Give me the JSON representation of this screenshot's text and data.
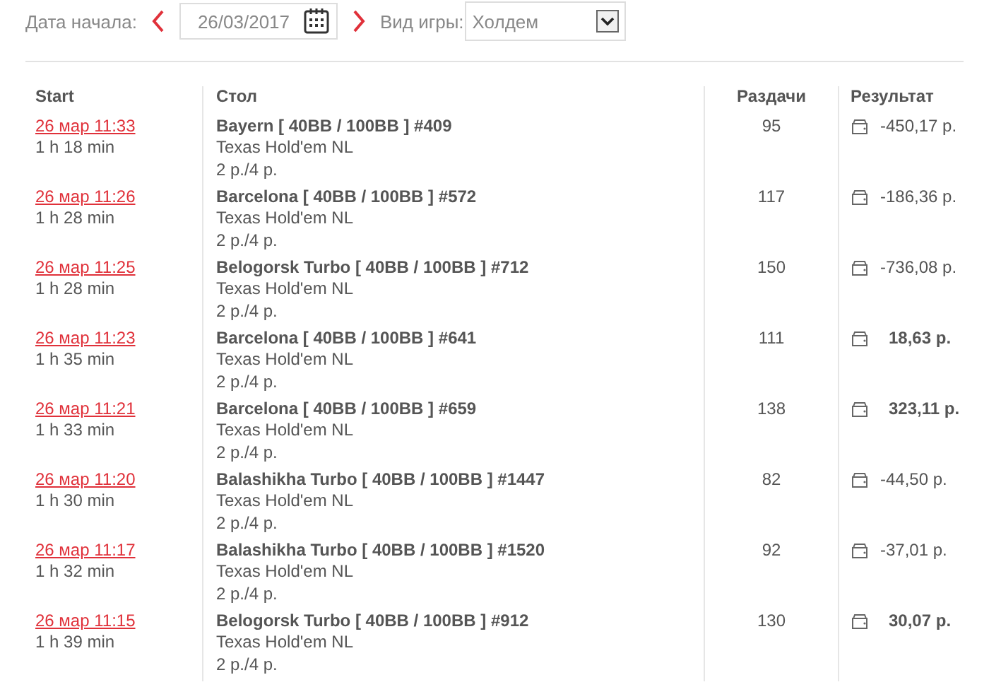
{
  "filter": {
    "date_label": "Дата начала:",
    "date_value": "26/03/2017",
    "game_label": "Вид игры:",
    "game_value": "Холдем"
  },
  "table": {
    "columns": [
      "Start",
      "Стол",
      "Раздачи",
      "Результат"
    ],
    "rows": [
      {
        "start": "26 мар 11:33",
        "duration": "1 h 18 min",
        "table": "Bayern [ 40BB / 100BB ] #409",
        "game": "Texas Hold'em NL",
        "stakes": "2 р./4 р.",
        "hands": "95",
        "result": "-450,17 р.",
        "win": false
      },
      {
        "start": "26 мар 11:26",
        "duration": "1 h 28 min",
        "table": "Barcelona [ 40BB / 100BB ] #572",
        "game": "Texas Hold'em NL",
        "stakes": "2 р./4 р.",
        "hands": "117",
        "result": "-186,36 р.",
        "win": false
      },
      {
        "start": "26 мар 11:25",
        "duration": "1 h 28 min",
        "table": "Belogorsk Turbo [ 40BB / 100BB ] #712",
        "game": "Texas Hold'em NL",
        "stakes": "2 р./4 р.",
        "hands": "150",
        "result": "-736,08 р.",
        "win": false
      },
      {
        "start": "26 мар 11:23",
        "duration": "1 h 35 min",
        "table": "Barcelona [ 40BB / 100BB ] #641",
        "game": "Texas Hold'em NL",
        "stakes": "2 р./4 р.",
        "hands": "111",
        "result": "18,63 р.",
        "win": true
      },
      {
        "start": "26 мар 11:21",
        "duration": "1 h 33 min",
        "table": "Barcelona [ 40BB / 100BB ] #659",
        "game": "Texas Hold'em NL",
        "stakes": "2 р./4 р.",
        "hands": "138",
        "result": "323,11 р.",
        "win": true
      },
      {
        "start": "26 мар 11:20",
        "duration": "1 h 30 min",
        "table": "Balashikha Turbo [ 40BB / 100BB ] #1447",
        "game": "Texas Hold'em NL",
        "stakes": "2 р./4 р.",
        "hands": "82",
        "result": "-44,50 р.",
        "win": false
      },
      {
        "start": "26 мар 11:17",
        "duration": "1 h 32 min",
        "table": "Balashikha Turbo [ 40BB / 100BB ] #1520",
        "game": "Texas Hold'em NL",
        "stakes": "2 р./4 р.",
        "hands": "92",
        "result": "-37,01 р.",
        "win": false
      },
      {
        "start": "26 мар 11:15",
        "duration": "1 h 39 min",
        "table": "Belogorsk Turbo [ 40BB / 100BB ] #912",
        "game": "Texas Hold'em NL",
        "stakes": "2 р./4 р.",
        "hands": "130",
        "result": "30,07 р.",
        "win": true
      }
    ]
  }
}
